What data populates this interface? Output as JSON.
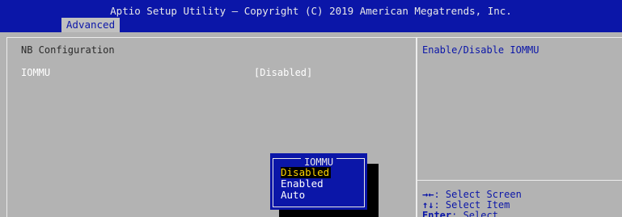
{
  "header": {
    "title": "Aptio Setup Utility – Copyright (C) 2019 American Megatrends, Inc.",
    "active_tab": "Advanced"
  },
  "main": {
    "section_title": "NB Configuration",
    "option": {
      "label": "IOMMU",
      "value": "[Disabled]"
    }
  },
  "help": {
    "description": "Enable/Disable IOMMU",
    "hints": [
      {
        "key": "→←",
        "text": ": Select Screen"
      },
      {
        "key": "↑↓",
        "text": ": Select Item"
      },
      {
        "key": "Enter",
        "text": ": Select"
      }
    ]
  },
  "popup": {
    "title": "IOMMU",
    "options": [
      "Disabled",
      "Enabled",
      "Auto"
    ],
    "selected_index": 0
  },
  "colors": {
    "header_blue": "#0b16a8",
    "panel_gray": "#b3b3b3",
    "highlight_text": "#ffd400"
  }
}
